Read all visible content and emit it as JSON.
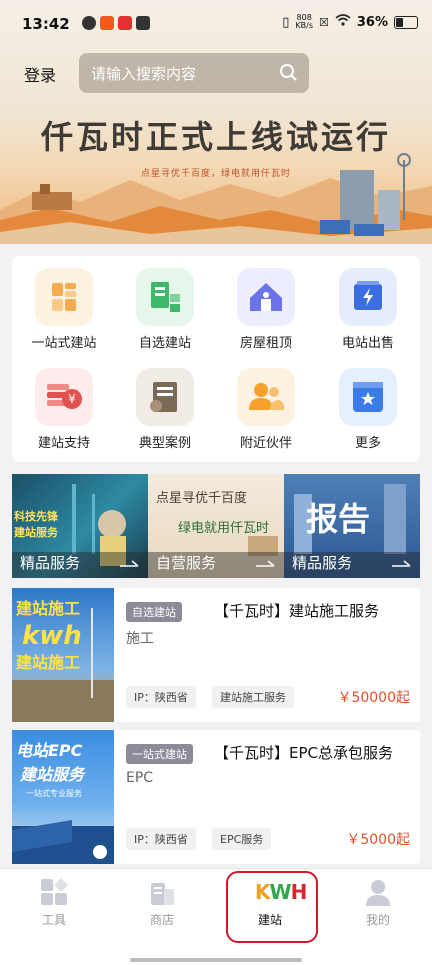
{
  "status_bar": {
    "time": "13:42",
    "network_speed_top": "808",
    "network_speed_unit": "KB/s",
    "battery_percent": "36%"
  },
  "header": {
    "login_label": "登录",
    "search_placeholder": "请输入搜索内容"
  },
  "banner": {
    "title": "仟瓦时正式上线试运行",
    "subtitle": "点星寻优千百度，绿电就用仟瓦时"
  },
  "categories": [
    {
      "label": "一站式建站",
      "icon": "one-stop-build-icon",
      "color": "#f6ab4e",
      "bg": "#fdf1e0"
    },
    {
      "label": "自选建站",
      "icon": "self-select-build-icon",
      "color": "#3fb86a",
      "bg": "#e6f6ea"
    },
    {
      "label": "房屋租顶",
      "icon": "house-roof-rent-icon",
      "color": "#6a74e8",
      "bg": "#eceeff"
    },
    {
      "label": "电站出售",
      "icon": "station-sale-icon",
      "color": "#3b6fe0",
      "bg": "#e6eefd"
    },
    {
      "label": "建站支持",
      "icon": "build-support-icon",
      "color": "#e2504f",
      "bg": "#fdeceb"
    },
    {
      "label": "典型案例",
      "icon": "typical-case-icon",
      "color": "#7b6a55",
      "bg": "#f1ece5"
    },
    {
      "label": "附近伙伴",
      "icon": "nearby-partner-icon",
      "color": "#f4a12e",
      "bg": "#fdf1e0"
    },
    {
      "label": "更多",
      "icon": "more-icon",
      "color": "#3b7be8",
      "bg": "#e6f0fd"
    }
  ],
  "services": [
    {
      "label": "精品服务",
      "overlay_text": "科技先锋 建站服务",
      "bg": "#1f5a6e"
    },
    {
      "label": "自营服务",
      "overlay_text": "点星寻优千百度 绿电就用仟瓦时",
      "bg": "#efe3cf"
    },
    {
      "label": "精品服务",
      "overlay_text": "报告",
      "bg": "#3f6ea8"
    }
  ],
  "products": [
    {
      "tag": "自选建站",
      "title": "【千瓦时】建站施工服务",
      "subtitle": "施工",
      "ip": "IP：陕西省",
      "category_pill": "建站施工服务",
      "price": "￥50000起",
      "thumb_text_top": "建站施工",
      "thumb_text_mid": "kwh",
      "thumb_text_bottom": "建站施工"
    },
    {
      "tag": "一站式建站",
      "title": "【千瓦时】EPC总承包服务",
      "subtitle": "EPC",
      "ip": "IP：陕西省",
      "category_pill": "EPC服务",
      "price": "￥5000起",
      "thumb_text_top": "电站EPC",
      "thumb_text_mid": "建站服务",
      "thumb_text_bottom": "一站式专业服务"
    }
  ],
  "bottom_nav": {
    "items": [
      {
        "label": "工具",
        "icon": "tools-icon"
      },
      {
        "label": "商店",
        "icon": "store-icon"
      },
      {
        "label": "建站",
        "icon": "kwh-logo-icon",
        "logo_text": "KWH"
      },
      {
        "label": "我的",
        "icon": "profile-icon"
      }
    ],
    "active_index": 2
  },
  "colors": {
    "accent_price": "#e0512b",
    "highlight_box": "#d0192a",
    "tag_bg": "#8c8c98"
  }
}
